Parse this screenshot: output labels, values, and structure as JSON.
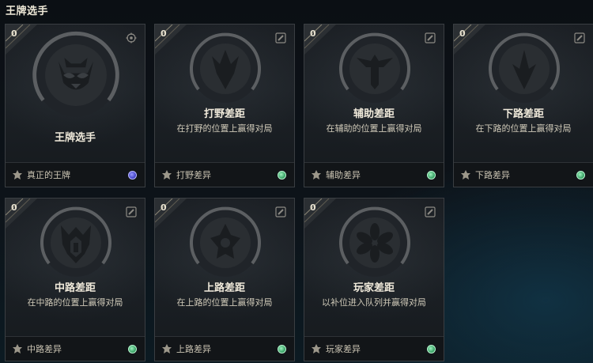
{
  "page_title": "王牌选手",
  "cards": [
    {
      "count": "0",
      "title": "王牌选手",
      "desc": "",
      "footer": "真正的王牌",
      "icon": "raccoon-emblem-icon",
      "corner_icon": "target-icon",
      "status_color": "#5a5ad8"
    },
    {
      "count": "0",
      "title": "打野差距",
      "desc": "在打野的位置上赢得对局",
      "footer": "打野差异",
      "icon": "jungle-emblem-icon",
      "corner_icon": "edit-icon",
      "status_color": "#3fae6a"
    },
    {
      "count": "0",
      "title": "辅助差距",
      "desc": "在辅助的位置上赢得对局",
      "footer": "辅助差异",
      "icon": "support-emblem-icon",
      "corner_icon": "edit-icon",
      "status_color": "#3fae6a"
    },
    {
      "count": "0",
      "title": "下路差距",
      "desc": "在下路的位置上赢得对局",
      "footer": "下路差异",
      "icon": "bottom-emblem-icon",
      "corner_icon": "edit-icon",
      "status_color": "#3fae6a"
    },
    {
      "count": "0",
      "title": "中路差距",
      "desc": "在中路的位置上赢得对局",
      "footer": "中路差异",
      "icon": "mid-emblem-icon",
      "corner_icon": "edit-icon",
      "status_color": "#3fae6a"
    },
    {
      "count": "0",
      "title": "上路差距",
      "desc": "在上路的位置上赢得对局",
      "footer": "上路差异",
      "icon": "top-emblem-icon",
      "corner_icon": "edit-icon",
      "status_color": "#3fae6a"
    },
    {
      "count": "0",
      "title": "玩家差距",
      "desc": "以补位进入队列并赢得对局",
      "footer": "玩家差异",
      "icon": "fill-emblem-icon",
      "corner_icon": "edit-icon",
      "status_color": "#3fae6a"
    }
  ]
}
